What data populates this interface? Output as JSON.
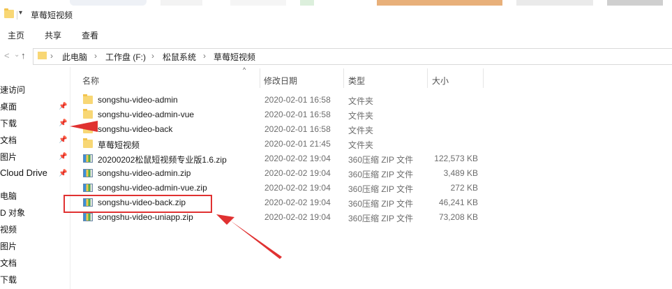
{
  "window": {
    "title": "草莓短视频",
    "title_dropdown_glyph": "▾"
  },
  "ribbon": {
    "tabs": [
      "主页",
      "共享",
      "查看"
    ]
  },
  "address": {
    "crumbs": [
      "此电脑",
      "工作盘 (F:)",
      "松鼠系统",
      "草莓短视频"
    ]
  },
  "nav_pane": {
    "items": [
      {
        "label": "速访问",
        "pinned": false
      },
      {
        "label": "桌面",
        "pinned": true
      },
      {
        "label": "下载",
        "pinned": true
      },
      {
        "label": "文档",
        "pinned": true
      },
      {
        "label": "图片",
        "pinned": true
      },
      {
        "label": "Cloud Drive",
        "pinned": true
      },
      {
        "label": "电脑",
        "pinned": false
      },
      {
        "label": "D 对象",
        "pinned": false
      },
      {
        "label": "视频",
        "pinned": false
      },
      {
        "label": "图片",
        "pinned": false
      },
      {
        "label": "文档",
        "pinned": false
      },
      {
        "label": "下载",
        "pinned": false
      }
    ]
  },
  "columns": {
    "name": "名称",
    "date": "修改日期",
    "type": "类型",
    "size": "大小"
  },
  "files": [
    {
      "icon": "folder-icon",
      "name": "songshu-video-admin",
      "date": "2020-02-01 16:58",
      "type": "文件夹",
      "size": ""
    },
    {
      "icon": "folder-icon",
      "name": "songshu-video-admin-vue",
      "date": "2020-02-01 16:58",
      "type": "文件夹",
      "size": ""
    },
    {
      "icon": "folder-icon",
      "name": "songshu-video-back",
      "date": "2020-02-01 16:58",
      "type": "文件夹",
      "size": ""
    },
    {
      "icon": "folder-icon",
      "name": "草莓短视频",
      "date": "2020-02-01 21:45",
      "type": "文件夹",
      "size": ""
    },
    {
      "icon": "zip-icon",
      "name": "20200202松鼠短视频专业版1.6.zip",
      "date": "2020-02-02 19:04",
      "type": "360压缩 ZIP 文件",
      "size": "122,573 KB"
    },
    {
      "icon": "zip-icon",
      "name": "songshu-video-admin.zip",
      "date": "2020-02-02 19:04",
      "type": "360压缩 ZIP 文件",
      "size": "3,489 KB"
    },
    {
      "icon": "zip-icon",
      "name": "songshu-video-admin-vue.zip",
      "date": "2020-02-02 19:04",
      "type": "360压缩 ZIP 文件",
      "size": "272 KB"
    },
    {
      "icon": "zip-icon",
      "name": "songshu-video-back.zip",
      "date": "2020-02-02 19:04",
      "type": "360压缩 ZIP 文件",
      "size": "46,241 KB"
    },
    {
      "icon": "zip-icon",
      "name": "songshu-video-uniapp.zip",
      "date": "2020-02-02 19:04",
      "type": "360压缩 ZIP 文件",
      "size": "73,208 KB"
    }
  ],
  "annotations": {
    "color": "#e03131",
    "highlighted_file": "songshu-video-back.zip"
  },
  "colors": {
    "folder": "#f8d775",
    "accent_annotation": "#e03131"
  }
}
